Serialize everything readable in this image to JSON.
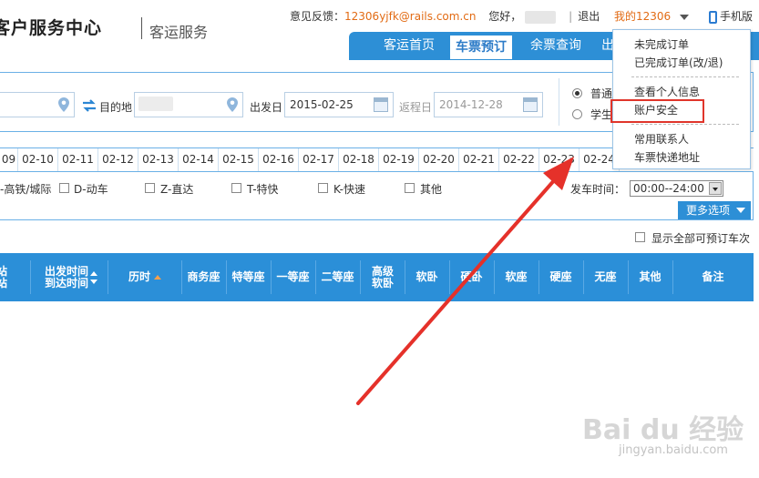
{
  "header": {
    "logo_text": "客户服务中心",
    "logo_sub": "客运服务",
    "feedback_label": "意见反馈：",
    "feedback_email": "12306yjfk@rails.com.cn",
    "greeting": "您好，",
    "logout": "退出",
    "my12306": "我的12306",
    "mobile": "手机版"
  },
  "nav": {
    "items": [
      "客运首页",
      "车票预订",
      "余票查询",
      "出"
    ],
    "active": "车票预订"
  },
  "search": {
    "to_label": "目的地",
    "depart_label": "出发日",
    "depart_value": "2015-02-25",
    "return_label": "返程日",
    "return_value": "2014-12-28",
    "ticket_types": [
      {
        "label": "普通",
        "selected": true
      },
      {
        "label": "学生",
        "selected": false
      }
    ]
  },
  "dates": [
    "09",
    "02-10",
    "02-11",
    "02-12",
    "02-13",
    "02-14",
    "02-15",
    "02-16",
    "02-17",
    "02-18",
    "02-19",
    "02-20",
    "02-21",
    "02-22",
    "02-23",
    "02-24"
  ],
  "filters": {
    "train_types": [
      "-高铁/城际",
      "D-动车",
      "Z-直达",
      "T-特快",
      "K-快速",
      "其他"
    ],
    "depart_time_label": "发车时间：",
    "depart_time_value": "00:00--24:00",
    "more_options": "更多选项",
    "show_all": "显示全部可预订车次"
  },
  "table": {
    "col_station_top": "站",
    "col_station_bottom": "站",
    "col_time_top": "出发时间",
    "col_time_bottom": "到达时间",
    "col_duration": "历时",
    "cols": [
      "商务座",
      "特等座",
      "一等座",
      "二等座",
      "高级软卧",
      "软卧",
      "硬卧",
      "软座",
      "硬座",
      "无座",
      "其他",
      "备注"
    ]
  },
  "dropdown": {
    "items": [
      "未完成订单",
      "已完成订单(改/退)",
      "查看个人信息",
      "账户安全",
      "常用联系人",
      "车票快递地址"
    ],
    "highlighted": "账户安全"
  },
  "watermark": {
    "main": "Bai du 经验",
    "sub": "jingyan.baidu.com"
  },
  "colors": {
    "nav_blue": "#2d8fd6",
    "link_orange": "#e26b14",
    "annotation_red": "#e0352b"
  }
}
